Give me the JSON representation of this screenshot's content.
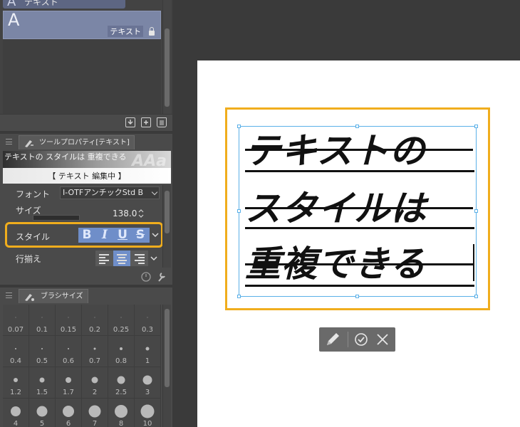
{
  "layers": {
    "top_layer_name": "テキスト",
    "selected_layer_glyph": "A",
    "selected_layer_name": "テキスト"
  },
  "tool_property": {
    "tab_title": "ツールプロパティ[テキスト]",
    "preview_title": "テキストの スタイルは 重複できる",
    "preview_status": "【 テキスト 編集中 】",
    "font_label": "フォント",
    "font_value": "I-OTFアンチックStd B",
    "size_label": "サイズ",
    "size_value": "138.0",
    "style_label": "スタイル",
    "style_buttons": [
      "B",
      "I",
      "U",
      "S"
    ],
    "align_label": "行揃え"
  },
  "brush_size": {
    "tab_title": "ブラシサイズ",
    "sizes": [
      "0.07",
      "0.1",
      "0.15",
      "0.2",
      "0.25",
      "0.3",
      "0.4",
      "0.5",
      "0.6",
      "0.7",
      "0.8",
      "1",
      "1.2",
      "1.5",
      "1.7",
      "2",
      "2.5",
      "3",
      "4",
      "5",
      "6",
      "7",
      "8",
      "10"
    ]
  },
  "canvas": {
    "lines": [
      "テキストの",
      "スタイルは",
      "重複できる"
    ]
  },
  "colors": {
    "accent": "#f0ad1d",
    "selection": "#6f8ec9",
    "frame_blue": "#5ab0e8"
  }
}
